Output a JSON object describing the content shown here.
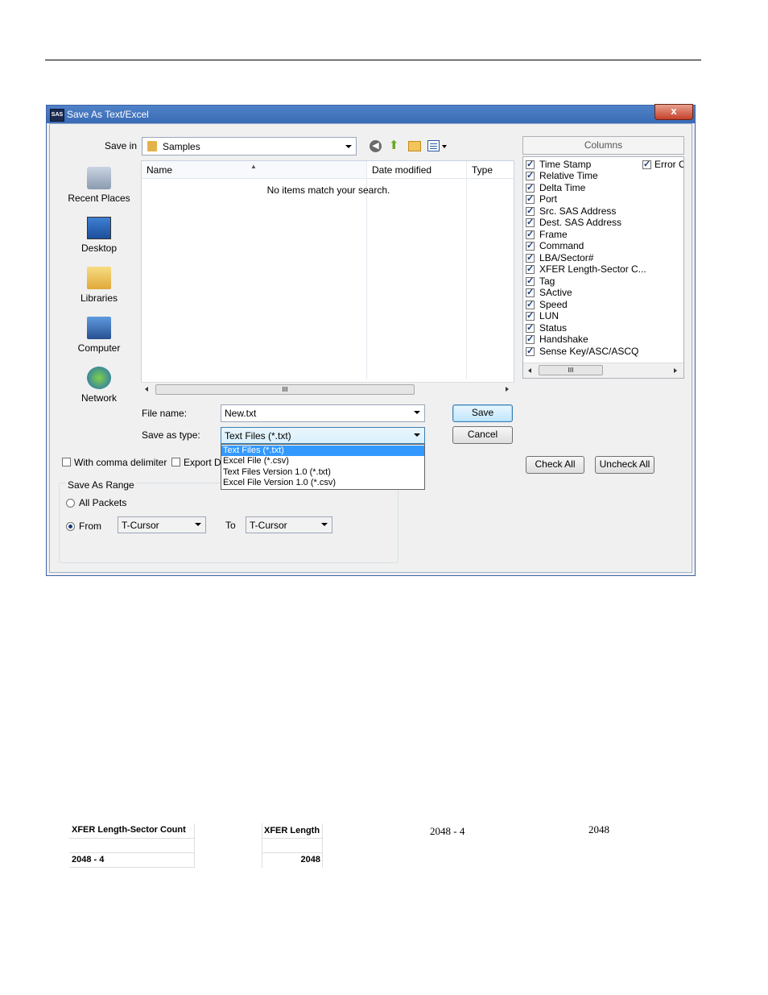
{
  "dialog": {
    "title": "Save As Text/Excel",
    "title_icon_text": "SAS",
    "close_label": "x",
    "save_in": {
      "label": "Save in",
      "value": "Samples"
    },
    "places": [
      "Recent Places",
      "Desktop",
      "Libraries",
      "Computer",
      "Network"
    ],
    "file_list": {
      "columns": [
        "Name",
        "Date modified",
        "Type"
      ],
      "empty_message": "No items match your search.",
      "scroll_thumb": "III"
    },
    "file_name": {
      "label": "File name:",
      "value": "New.txt"
    },
    "save_as_type": {
      "label": "Save as type:",
      "value": "Text Files (*.txt)",
      "options": [
        "Text Files (*.txt)",
        "Excel File (*.csv)",
        "Text Files Version 1.0 (*.txt)",
        "Excel File Version 1.0 (*.csv)"
      ]
    },
    "buttons": {
      "save": "Save",
      "cancel": "Cancel",
      "check_all": "Check All",
      "uncheck_all": "Uncheck All"
    },
    "options": {
      "comma_delimiter": "With comma delimiter",
      "export": "Export D"
    },
    "range": {
      "title": "Save As Range",
      "all_packets": "All Packets",
      "from_label": "From",
      "from_value": "T-Cursor",
      "to_label": "To",
      "to_value": "T-Cursor"
    },
    "columns_panel": {
      "header": "Columns",
      "error_label": "Error O",
      "items": [
        "Time Stamp",
        "Relative Time",
        "Delta Time",
        "Port",
        "Src. SAS Address",
        "Dest. SAS Address",
        "Frame",
        "Command",
        "LBA/Sector#",
        "XFER Length-Sector C...",
        "Tag",
        "SActive",
        "Speed",
        "LUN",
        "Status",
        "Handshake",
        "Sense Key/ASC/ASCQ"
      ],
      "scroll_thumb": "III"
    }
  },
  "bottom": {
    "table1": {
      "header": "XFER Length-Sector Count",
      "value": "2048 - 4"
    },
    "table2": {
      "header": "XFER Length",
      "value": "2048"
    },
    "text1": "2048  -  4",
    "text2": "2048"
  }
}
